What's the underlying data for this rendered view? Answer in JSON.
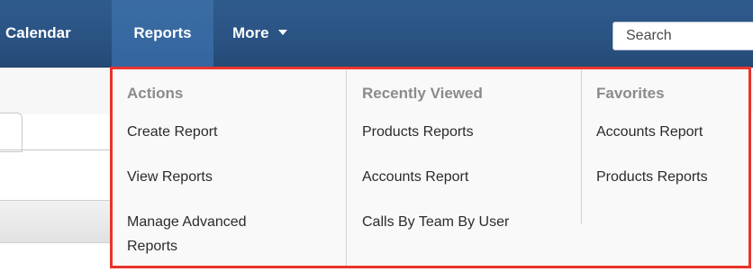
{
  "nav": {
    "items": [
      {
        "label": "Calendar"
      },
      {
        "label": "Reports"
      },
      {
        "label": "More"
      }
    ],
    "search_placeholder": "Search"
  },
  "colors": {
    "navbar": "#2a5383",
    "active_tab": "#3565a0",
    "highlight_border": "#e8342b",
    "menu_bg": "#f9f9f9",
    "section_title": "#8b8b8b"
  },
  "dropdown": {
    "columns": [
      {
        "title": "Actions",
        "items": [
          {
            "label": "Create Report"
          },
          {
            "label": "View Reports"
          },
          {
            "label": "Manage Advanced Reports"
          }
        ]
      },
      {
        "title": "Recently Viewed",
        "items": [
          {
            "label": "Products Reports"
          },
          {
            "label": "Accounts Report"
          },
          {
            "label": "Calls By Team By User"
          }
        ]
      },
      {
        "title": "Favorites",
        "items": [
          {
            "label": "Accounts Report"
          },
          {
            "label": "Products Reports"
          }
        ]
      }
    ]
  }
}
